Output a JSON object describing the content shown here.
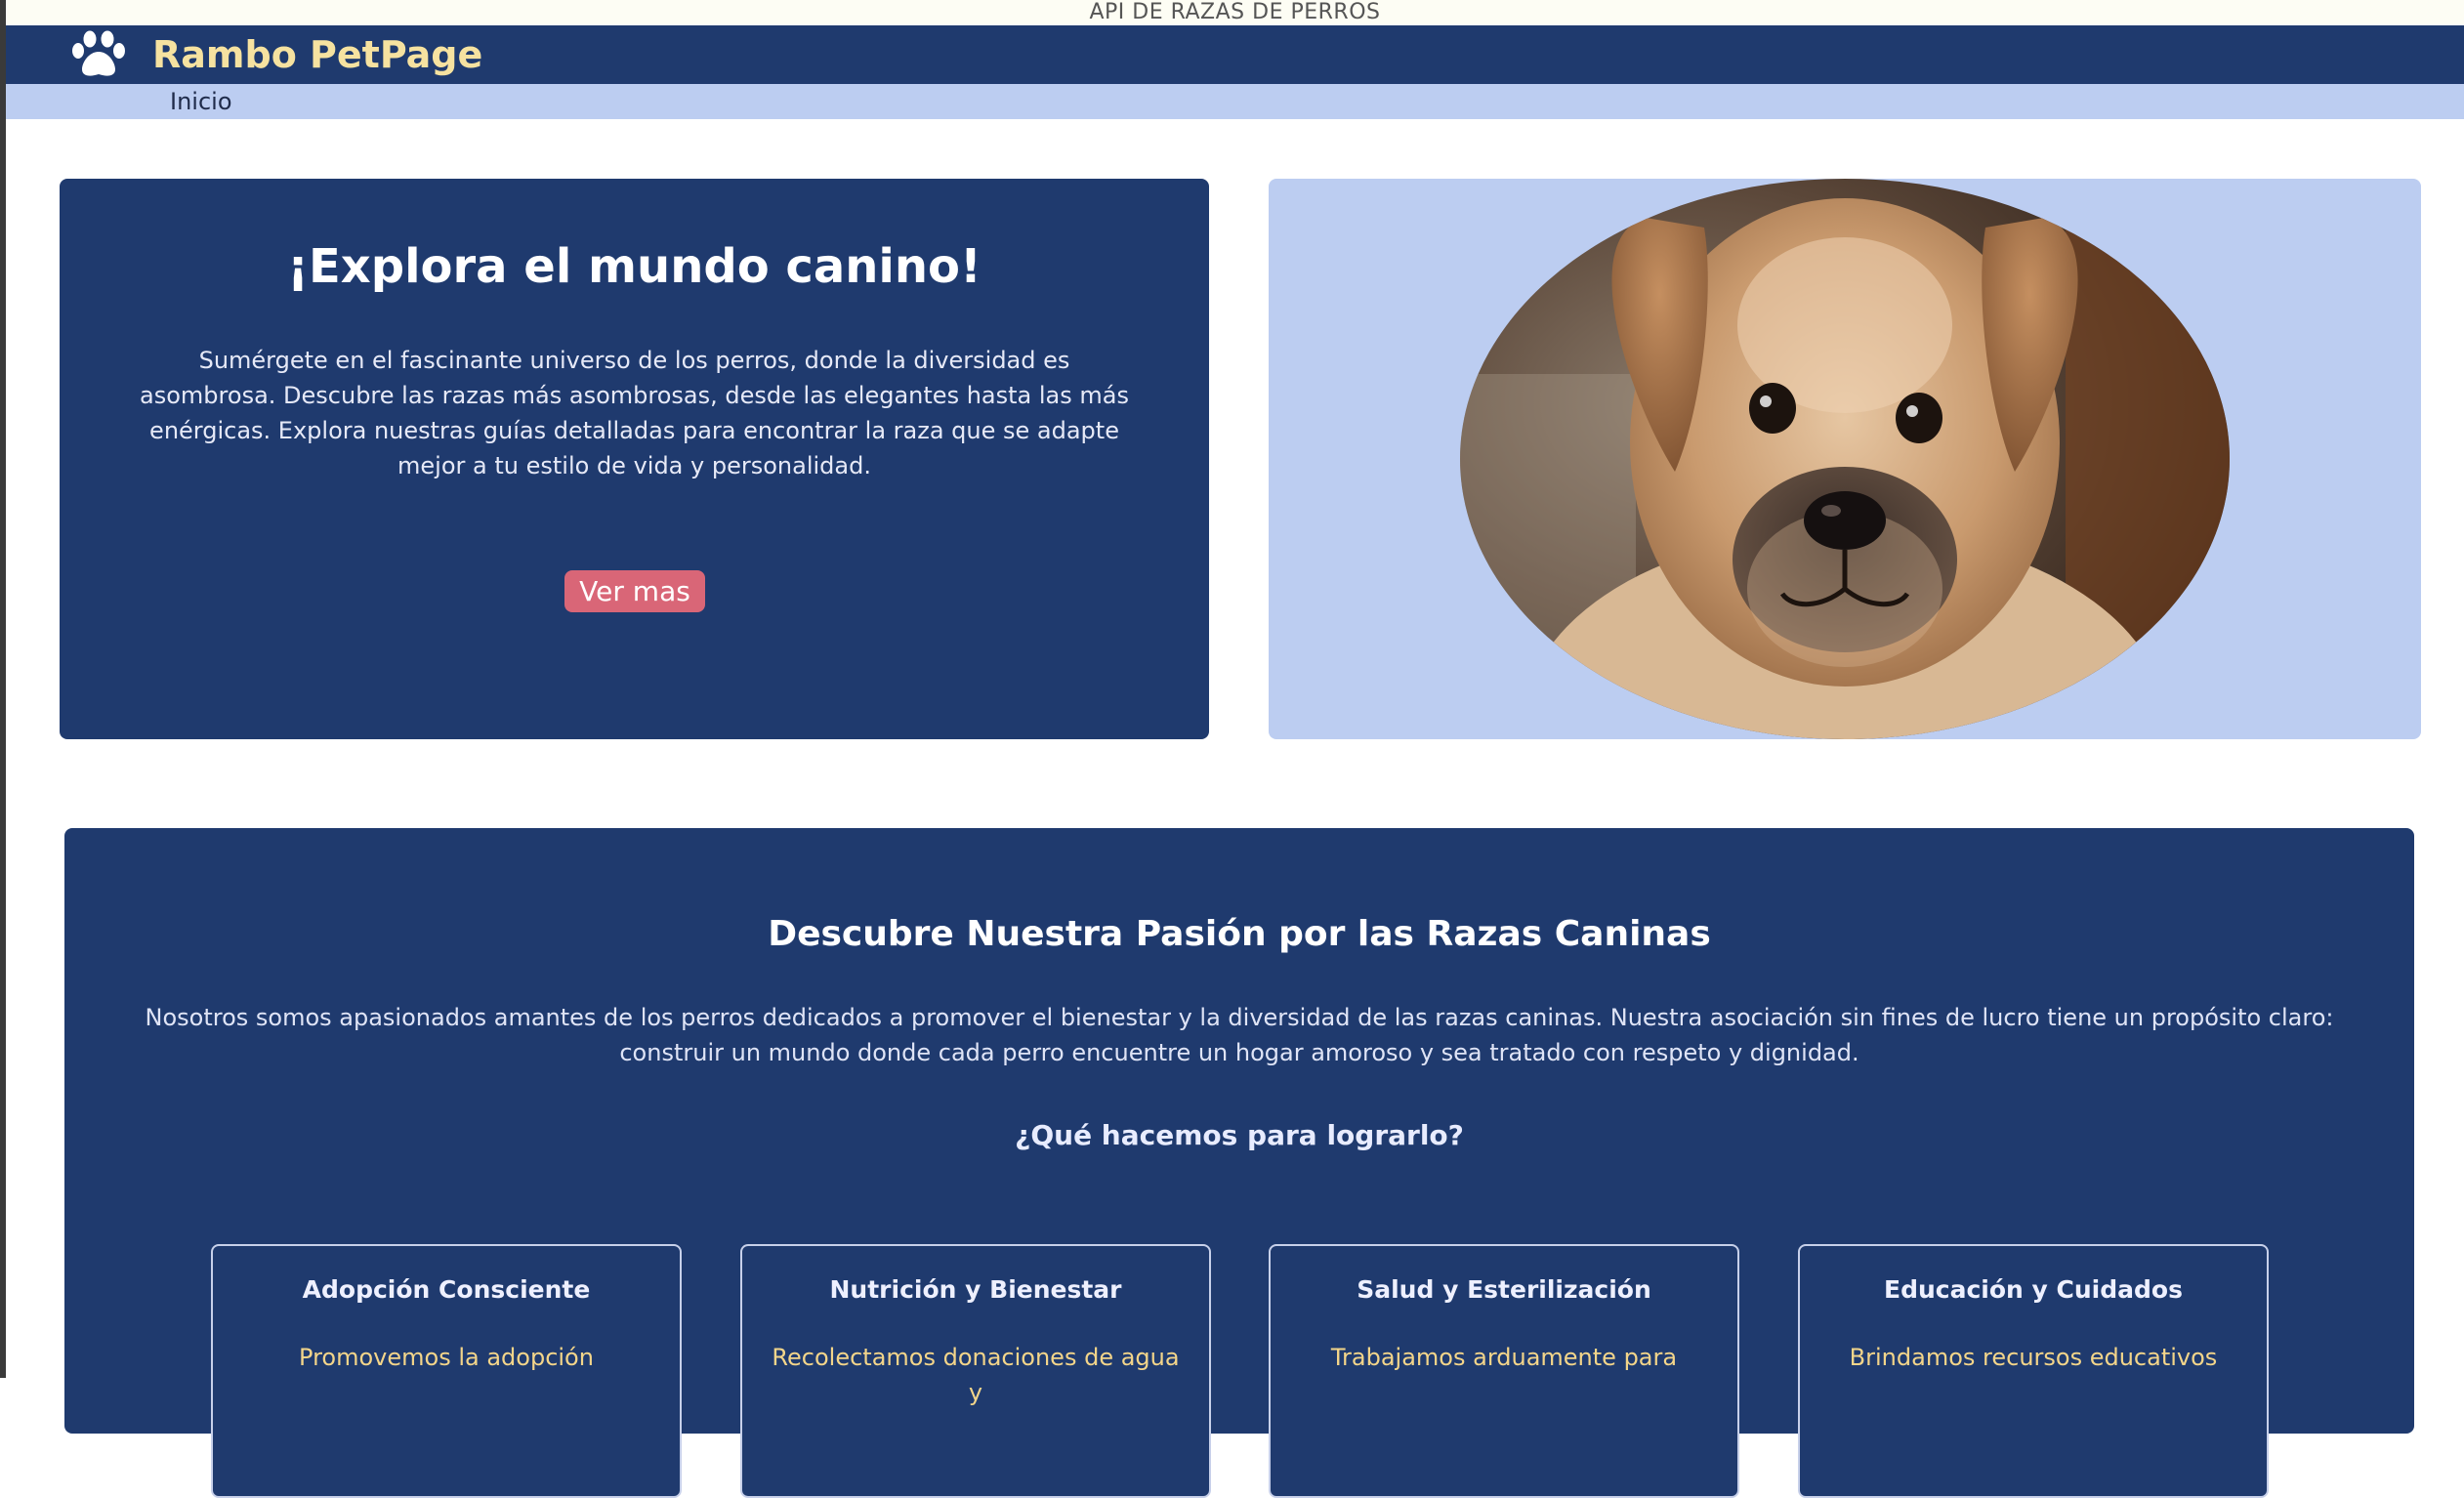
{
  "browser": {
    "title": "API DE RAZAS DE PERROS"
  },
  "header": {
    "brand": "Rambo PetPage",
    "logo_icon": "paw-icon"
  },
  "nav": {
    "items": [
      {
        "label": "Inicio"
      }
    ]
  },
  "hero": {
    "title": "¡Explora el mundo canino!",
    "text": "Sumérgete en el fascinante universo de los perros, donde la diversidad es asombrosa. Descubre las razas más asombrosas, desde las elegantes hasta las más enérgicas. Explora nuestras guías detalladas para encontrar la raza que se adapte mejor a tu estilo de vida y personalidad.",
    "button": "Ver mas",
    "image": "puppy-photo"
  },
  "about": {
    "title": "Descubre Nuestra Pasión por las Razas Caninas",
    "text": "Nosotros somos apasionados amantes de los perros dedicados a promover el bienestar y la diversidad de las razas caninas. Nuestra asociación sin fines de lucro tiene un propósito claro: construir un mundo donde cada perro encuentre un hogar amoroso y sea tratado con respeto y dignidad.",
    "question": "¿Qué hacemos para lograrlo?",
    "cards": [
      {
        "title": "Adopción Consciente",
        "text": "Promovemos la adopción"
      },
      {
        "title": "Nutrición y Bienestar",
        "text": "Recolectamos donaciones de agua y"
      },
      {
        "title": "Salud y Esterilización",
        "text": "Trabajamos arduamente para"
      },
      {
        "title": "Educación y Cuidados",
        "text": "Brindamos recursos educativos"
      }
    ]
  },
  "colors": {
    "navy": "#1f3a6e",
    "light_blue": "#bccdf1",
    "brand_yellow": "#f6e2a0",
    "button_pink": "#d96677",
    "card_text_yellow": "#f3d58a"
  }
}
